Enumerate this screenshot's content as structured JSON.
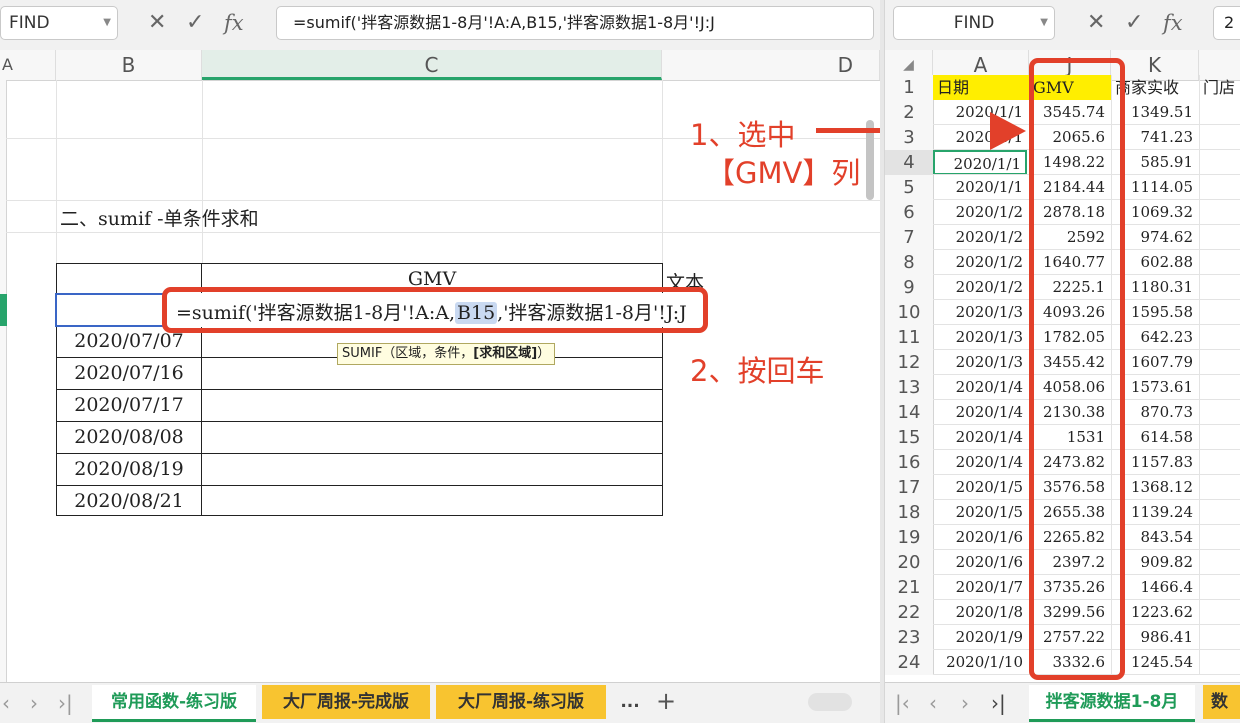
{
  "left": {
    "namebox": "FIND",
    "formula": "=sumif('拌客源数据1-8月'!A:A,B15,'拌客源数据1-8月'!J:J",
    "col_headers": [
      "A",
      "B",
      "C",
      "D"
    ],
    "section_title": "二、sumif -单条件求和",
    "table_header_gmv": "GMV",
    "col_d_text": "文本",
    "edit_prefix": "=sumif('拌客源数据1-8月'!A:A,",
    "edit_ref": "B15",
    "edit_suffix": ",'拌客源数据1-8月'!J:J",
    "tooltip_prefix": "SUMIF（区域，条件，",
    "tooltip_bold": "[求和区域]",
    "tooltip_suffix": "）",
    "dates": [
      "2020/07/07",
      "2020/07/16",
      "2020/07/17",
      "2020/08/08",
      "2020/08/19",
      "2020/08/21"
    ],
    "tabs": [
      "常用函数-练习版",
      "大厂周报-完成版",
      "大厂周报-练习版"
    ],
    "more": "...",
    "add": "+"
  },
  "right": {
    "namebox": "FIND",
    "next_cell": "2",
    "col_headers": [
      "A",
      "J",
      "K"
    ],
    "headers": [
      "日期",
      "GMV",
      "商家实收",
      "门店"
    ],
    "rows": [
      {
        "n": "2",
        "date": "2020/1/1",
        "gmv": "3545.74",
        "k": "1349.51"
      },
      {
        "n": "3",
        "date": "2020/1/1",
        "gmv": "2065.6",
        "k": "741.23"
      },
      {
        "n": "4",
        "date": "2020/1/1",
        "gmv": "1498.22",
        "k": "585.91"
      },
      {
        "n": "5",
        "date": "2020/1/1",
        "gmv": "2184.44",
        "k": "1114.05"
      },
      {
        "n": "6",
        "date": "2020/1/2",
        "gmv": "2878.18",
        "k": "1069.32"
      },
      {
        "n": "7",
        "date": "2020/1/2",
        "gmv": "2592",
        "k": "974.62"
      },
      {
        "n": "8",
        "date": "2020/1/2",
        "gmv": "1640.77",
        "k": "602.88"
      },
      {
        "n": "9",
        "date": "2020/1/2",
        "gmv": "2225.1",
        "k": "1180.31"
      },
      {
        "n": "10",
        "date": "2020/1/3",
        "gmv": "4093.26",
        "k": "1595.58"
      },
      {
        "n": "11",
        "date": "2020/1/3",
        "gmv": "1782.05",
        "k": "642.23"
      },
      {
        "n": "12",
        "date": "2020/1/3",
        "gmv": "3455.42",
        "k": "1607.79"
      },
      {
        "n": "13",
        "date": "2020/1/4",
        "gmv": "4058.06",
        "k": "1573.61"
      },
      {
        "n": "14",
        "date": "2020/1/4",
        "gmv": "2130.38",
        "k": "870.73"
      },
      {
        "n": "15",
        "date": "2020/1/4",
        "gmv": "1531",
        "k": "614.58"
      },
      {
        "n": "16",
        "date": "2020/1/4",
        "gmv": "2473.82",
        "k": "1157.83"
      },
      {
        "n": "17",
        "date": "2020/1/5",
        "gmv": "3576.58",
        "k": "1368.12"
      },
      {
        "n": "18",
        "date": "2020/1/5",
        "gmv": "2655.38",
        "k": "1139.24"
      },
      {
        "n": "19",
        "date": "2020/1/6",
        "gmv": "2265.82",
        "k": "843.54"
      },
      {
        "n": "20",
        "date": "2020/1/6",
        "gmv": "2397.2",
        "k": "909.82"
      },
      {
        "n": "21",
        "date": "2020/1/7",
        "gmv": "3735.26",
        "k": "1466.4"
      },
      {
        "n": "22",
        "date": "2020/1/8",
        "gmv": "3299.56",
        "k": "1223.62"
      },
      {
        "n": "23",
        "date": "2020/1/9",
        "gmv": "2757.22",
        "k": "986.41"
      },
      {
        "n": "24",
        "date": "2020/1/10",
        "gmv": "3332.6",
        "k": "1245.54"
      }
    ],
    "tab": "拌客源数据1-8月",
    "tab2": "数"
  },
  "annotations": {
    "step1_line1": "1、选中",
    "step1_line2": "【GMV】列",
    "step2": "2、按回车",
    "color": "#e2402a"
  }
}
